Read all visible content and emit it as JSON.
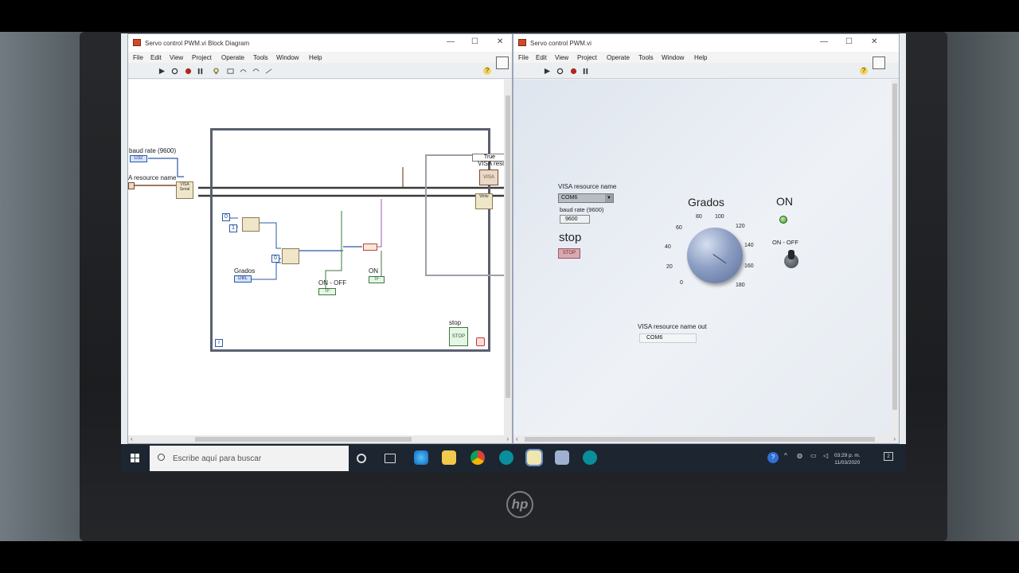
{
  "block_diagram": {
    "title": "Servo control PWM.vi Block Diagram",
    "menu": [
      "File",
      "Edit",
      "View",
      "Project",
      "Operate",
      "Tools",
      "Window",
      "Help"
    ],
    "labels": {
      "baud_rate": "baud rate (9600)",
      "visa_resource": "A resource name",
      "visa_out": "VISA resource name out",
      "case_value": "True",
      "grados": "Grados",
      "on_off": "ON - OFF",
      "on": "ON",
      "stop": "stop"
    },
    "constants": {
      "c0a": "0",
      "c1": "1",
      "c0b": "0",
      "iteration": "i"
    },
    "terminal_text": {
      "baud": "U32",
      "visa": "I/O",
      "grados": "DBL",
      "on_off": "TF",
      "on": "TF",
      "stop_term": "STOP",
      "visa_out": "VISA",
      "write": "Write"
    }
  },
  "front_panel": {
    "title": "Servo control PWM.vi",
    "menu": [
      "File",
      "Edit",
      "View",
      "Project",
      "Operate",
      "Tools",
      "Window",
      "Help"
    ],
    "visa_label": "VISA resource name",
    "visa_value": "COM6",
    "baud_label": "baud rate (9600)",
    "baud_value": "9600",
    "stop_label": "stop",
    "stop_button": "STOP",
    "knob_label": "Grados",
    "knob_ticks": [
      "0",
      "20",
      "40",
      "60",
      "80",
      "100",
      "120",
      "140",
      "160",
      "180"
    ],
    "led_label": "ON",
    "switch_label": "ON - OFF",
    "visa_out_label": "VISA resource name out",
    "visa_out_value": "COM6"
  },
  "taskbar": {
    "search_placeholder": "Escribe aquí para buscar",
    "time": "03:29 p. m.",
    "date": "11/03/2020",
    "notifications": "2"
  },
  "laptop": {
    "brand": "hp"
  }
}
